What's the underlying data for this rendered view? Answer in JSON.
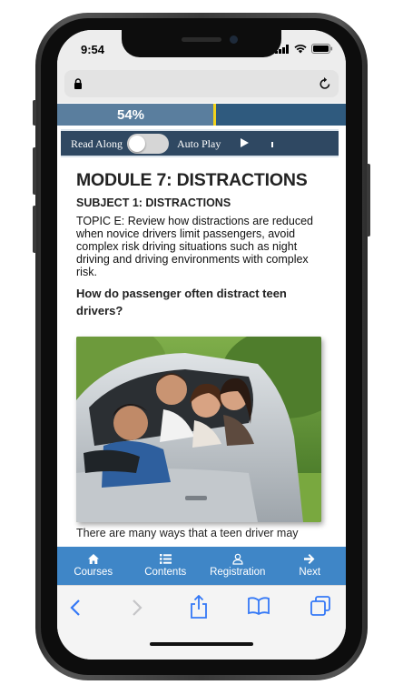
{
  "status": {
    "time": "9:54"
  },
  "progress": {
    "label": "54%",
    "value": 0.54
  },
  "controls": {
    "read_along_label": "Read Along",
    "auto_play_label": "Auto Play"
  },
  "content": {
    "module_title": "MODULE 7: DISTRACTIONS",
    "subject_title": "SUBJECT 1: DISTRACTIONS",
    "topic_text": "TOPIC E: Review how distractions are reduced when novice drivers limit passengers, avoid complex risk driving situations such as night driving and driving environments with complex risk.",
    "question": "How do passenger often distract teen drivers?",
    "body_text": "There are many ways that a teen driver may"
  },
  "tabbar": {
    "items": [
      {
        "label": "Courses",
        "icon": "home-icon"
      },
      {
        "label": "Contents",
        "icon": "list-icon"
      },
      {
        "label": "Registration",
        "icon": "user-icon"
      },
      {
        "label": "Next",
        "icon": "arrow-right-icon"
      }
    ]
  },
  "colors": {
    "progress_bg": "#2f5a7e",
    "readbar_bg": "#2f4862",
    "tabbar_bg": "#3f86c7",
    "marker": "#f2d21b",
    "safari_tint": "#3478f6"
  }
}
